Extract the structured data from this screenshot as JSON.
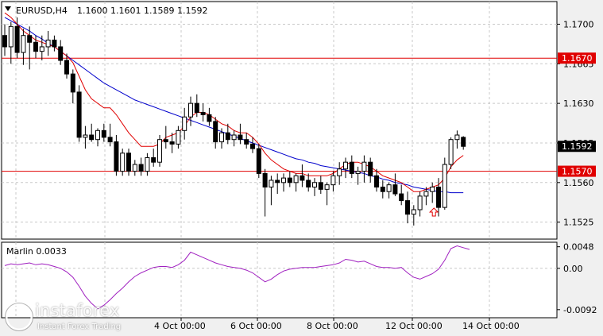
{
  "window": {
    "symbol_title": "EURUSD,H4",
    "ohlc": "1.1600 1.1601 1.1589 1.1592"
  },
  "indicator": {
    "name": "Marlin 0.0033",
    "ticks": [
      "0.0048",
      "0.00",
      "-0.0092"
    ],
    "color": "#a020c0"
  },
  "watermark": {
    "brand": "instaforex",
    "tagline": "Instant Forex Trading"
  },
  "colors": {
    "bull_candle": "#ffffff",
    "bear_candle": "#000000",
    "ma_fast": "#e00000",
    "ma_slow": "#0000cc",
    "level_line": "#e00000",
    "price_badge": "#000000",
    "level_badge": "#e00000",
    "arrow": "#e00000"
  },
  "chart_data": {
    "type": "candlestick",
    "title": "EURUSD,H4",
    "y_ticks": [
      "1.1700",
      "1.1665",
      "1.1630",
      "1.1595",
      "1.1560",
      "1.1525"
    ],
    "ylim": [
      1.151,
      1.172
    ],
    "x_ticks": [
      "4 Oct 00:00",
      "6 Oct 00:00",
      "8 Oct 00:00",
      "12 Oct 00:00",
      "14 Oct 00:00"
    ],
    "current_price": "1.1592",
    "levels": [
      "1.1670",
      "1.1570"
    ],
    "grid": true,
    "candles": [
      [
        1.169,
        1.17,
        1.1672,
        1.168
      ],
      [
        1.168,
        1.1702,
        1.1665,
        1.1698
      ],
      [
        1.1698,
        1.1706,
        1.167,
        1.1675
      ],
      [
        1.1675,
        1.1696,
        1.1664,
        1.169
      ],
      [
        1.169,
        1.1698,
        1.166,
        1.1684
      ],
      [
        1.1684,
        1.169,
        1.167,
        1.1676
      ],
      [
        1.1676,
        1.169,
        1.1668,
        1.168
      ],
      [
        1.168,
        1.1694,
        1.1672,
        1.1686
      ],
      [
        1.1686,
        1.169,
        1.1676,
        1.168
      ],
      [
        1.168,
        1.1686,
        1.1664,
        1.1668
      ],
      [
        1.1668,
        1.1674,
        1.1652,
        1.1656
      ],
      [
        1.1656,
        1.166,
        1.163,
        1.164
      ],
      [
        1.164,
        1.1646,
        1.1596,
        1.16
      ],
      [
        1.16,
        1.161,
        1.159,
        1.1602
      ],
      [
        1.1602,
        1.1612,
        1.1596,
        1.1598
      ],
      [
        1.1598,
        1.1608,
        1.1592,
        1.1606
      ],
      [
        1.1606,
        1.1612,
        1.1596,
        1.16
      ],
      [
        1.16,
        1.1612,
        1.1592,
        1.1596
      ],
      [
        1.1596,
        1.1602,
        1.1566,
        1.157
      ],
      [
        1.157,
        1.159,
        1.1566,
        1.1586
      ],
      [
        1.1586,
        1.159,
        1.1566,
        1.157
      ],
      [
        1.157,
        1.158,
        1.1566,
        1.1576
      ],
      [
        1.1576,
        1.1582,
        1.1566,
        1.157
      ],
      [
        1.157,
        1.1586,
        1.1566,
        1.1582
      ],
      [
        1.1582,
        1.159,
        1.1574,
        1.1578
      ],
      [
        1.1578,
        1.1602,
        1.1574,
        1.1598
      ],
      [
        1.1598,
        1.161,
        1.159,
        1.1596
      ],
      [
        1.1596,
        1.1604,
        1.1586,
        1.1594
      ],
      [
        1.1594,
        1.161,
        1.159,
        1.1606
      ],
      [
        1.1606,
        1.1626,
        1.1598,
        1.1618
      ],
      [
        1.1618,
        1.1636,
        1.161,
        1.163
      ],
      [
        1.163,
        1.1638,
        1.1618,
        1.1622
      ],
      [
        1.1622,
        1.163,
        1.1614,
        1.162
      ],
      [
        1.162,
        1.1626,
        1.161,
        1.1614
      ],
      [
        1.1614,
        1.1618,
        1.159,
        1.1596
      ],
      [
        1.1596,
        1.1608,
        1.159,
        1.1604
      ],
      [
        1.1604,
        1.1612,
        1.1594,
        1.1598
      ],
      [
        1.1598,
        1.1606,
        1.1592,
        1.1602
      ],
      [
        1.1602,
        1.1612,
        1.1594,
        1.1598
      ],
      [
        1.1598,
        1.1604,
        1.159,
        1.1594
      ],
      [
        1.1594,
        1.16,
        1.1586,
        1.159
      ],
      [
        1.159,
        1.1594,
        1.1564,
        1.1568
      ],
      [
        1.1568,
        1.1572,
        1.153,
        1.1556
      ],
      [
        1.1556,
        1.1566,
        1.154,
        1.1562
      ],
      [
        1.1562,
        1.1568,
        1.155,
        1.156
      ],
      [
        1.156,
        1.1568,
        1.1552,
        1.1564
      ],
      [
        1.1564,
        1.157,
        1.1556,
        1.156
      ],
      [
        1.156,
        1.1568,
        1.1552,
        1.1566
      ],
      [
        1.1566,
        1.1576,
        1.1556,
        1.1562
      ],
      [
        1.1562,
        1.1568,
        1.1552,
        1.1556
      ],
      [
        1.1556,
        1.1564,
        1.1548,
        1.156
      ],
      [
        1.156,
        1.1566,
        1.155,
        1.1554
      ],
      [
        1.1554,
        1.156,
        1.154,
        1.1558
      ],
      [
        1.1558,
        1.157,
        1.1552,
        1.1566
      ],
      [
        1.1566,
        1.1578,
        1.1558,
        1.1572
      ],
      [
        1.1572,
        1.1582,
        1.1564,
        1.1578
      ],
      [
        1.1578,
        1.1584,
        1.1564,
        1.1568
      ],
      [
        1.1568,
        1.1574,
        1.1558,
        1.157
      ],
      [
        1.157,
        1.1584,
        1.156,
        1.1578
      ],
      [
        1.1578,
        1.1582,
        1.156,
        1.1566
      ],
      [
        1.1566,
        1.1572,
        1.1552,
        1.1556
      ],
      [
        1.1556,
        1.1562,
        1.1546,
        1.1552
      ],
      [
        1.1552,
        1.156,
        1.1546,
        1.1558
      ],
      [
        1.1558,
        1.1568,
        1.1548,
        1.155
      ],
      [
        1.155,
        1.1558,
        1.154,
        1.1544
      ],
      [
        1.1544,
        1.1552,
        1.1524,
        1.1532
      ],
      [
        1.1532,
        1.154,
        1.1522,
        1.1536
      ],
      [
        1.1536,
        1.1552,
        1.153,
        1.1548
      ],
      [
        1.1548,
        1.1556,
        1.154,
        1.1552
      ],
      [
        1.1552,
        1.156,
        1.1542,
        1.1556
      ],
      [
        1.1556,
        1.1564,
        1.153,
        1.1538
      ],
      [
        1.1538,
        1.1582,
        1.1536,
        1.1576
      ],
      [
        1.1576,
        1.16,
        1.1572,
        1.1598
      ],
      [
        1.1598,
        1.1606,
        1.159,
        1.1602
      ],
      [
        1.16,
        1.1601,
        1.1589,
        1.1592
      ]
    ],
    "ma_fast": [
      1.171,
      1.1706,
      1.17,
      1.1694,
      1.169,
      1.1686,
      1.1684,
      1.1682,
      1.168,
      1.1676,
      1.1672,
      1.1666,
      1.1654,
      1.1642,
      1.1634,
      1.163,
      1.1626,
      1.1626,
      1.162,
      1.1612,
      1.1604,
      1.1598,
      1.1592,
      1.1592,
      1.1592,
      1.1594,
      1.16,
      1.1602,
      1.1604,
      1.161,
      1.1618,
      1.1622,
      1.1622,
      1.162,
      1.1616,
      1.1612,
      1.161,
      1.1606,
      1.1604,
      1.1604,
      1.16,
      1.1594,
      1.1586,
      1.158,
      1.1576,
      1.1572,
      1.157,
      1.1568,
      1.1568,
      1.1566,
      1.1566,
      1.1566,
      1.1566,
      1.1568,
      1.1572,
      1.1576,
      1.1578,
      1.1578,
      1.1576,
      1.1574,
      1.157,
      1.1566,
      1.1564,
      1.1562,
      1.156,
      1.1556,
      1.1552,
      1.1552,
      1.1554,
      1.1556,
      1.1558,
      1.1564,
      1.1574,
      1.158,
      1.1584
    ],
    "ma_slow": [
      1.1706,
      1.1703,
      1.17,
      1.1697,
      1.1694,
      1.169,
      1.1687,
      1.1683,
      1.168,
      1.1676,
      1.1672,
      1.1668,
      1.1664,
      1.166,
      1.1656,
      1.1652,
      1.1648,
      1.1645,
      1.1642,
      1.1639,
      1.1636,
      1.1633,
      1.1631,
      1.1629,
      1.1627,
      1.1625,
      1.1623,
      1.1621,
      1.1619,
      1.1617,
      1.1615,
      1.1613,
      1.1611,
      1.1609,
      1.1607,
      1.1605,
      1.1603,
      1.1601,
      1.1599,
      1.1597,
      1.1595,
      1.1593,
      1.1591,
      1.1589,
      1.1587,
      1.1585,
      1.1583,
      1.1581,
      1.158,
      1.1578,
      1.1577,
      1.1575,
      1.1574,
      1.1573,
      1.1572,
      1.1571,
      1.157,
      1.1569,
      1.1568,
      1.1566,
      1.1565,
      1.1563,
      1.1562,
      1.156,
      1.1559,
      1.1558,
      1.1556,
      1.1555,
      1.1554,
      1.1553,
      1.1552,
      1.1552,
      1.1551,
      1.1551,
      1.1551
    ],
    "marlin": [
      0.0006,
      0.001,
      0.0008,
      0.001,
      0.0012,
      0.0008,
      0.001,
      0.0008,
      0.0004,
      0.0,
      -0.0008,
      -0.002,
      -0.004,
      -0.0062,
      -0.0078,
      -0.009,
      -0.0082,
      -0.007,
      -0.0056,
      -0.0044,
      -0.003,
      -0.0018,
      -0.001,
      -0.0004,
      0.0002,
      0.0004,
      0.0004,
      0.0002,
      0.0008,
      0.0018,
      0.0036,
      0.003,
      0.0024,
      0.0018,
      0.0012,
      0.0008,
      0.0004,
      0.0002,
      0.0,
      -0.0004,
      -0.001,
      -0.002,
      -0.003,
      -0.0024,
      -0.0014,
      -0.0006,
      -0.0002,
      0.0,
      0.0002,
      0.0002,
      0.0002,
      0.0004,
      0.0006,
      0.0008,
      0.0012,
      0.002,
      0.0018,
      0.0014,
      0.0016,
      0.001,
      0.0004,
      0.0002,
      0.0002,
      0.0,
      0.0002,
      -0.001,
      -0.002,
      -0.0024,
      -0.0018,
      -0.0012,
      -0.0002,
      0.0018,
      0.0044,
      0.005,
      0.0046,
      0.0042
    ],
    "marlin_ylim": [
      -0.011,
      0.0058
    ],
    "arrow_at_index": 69
  }
}
